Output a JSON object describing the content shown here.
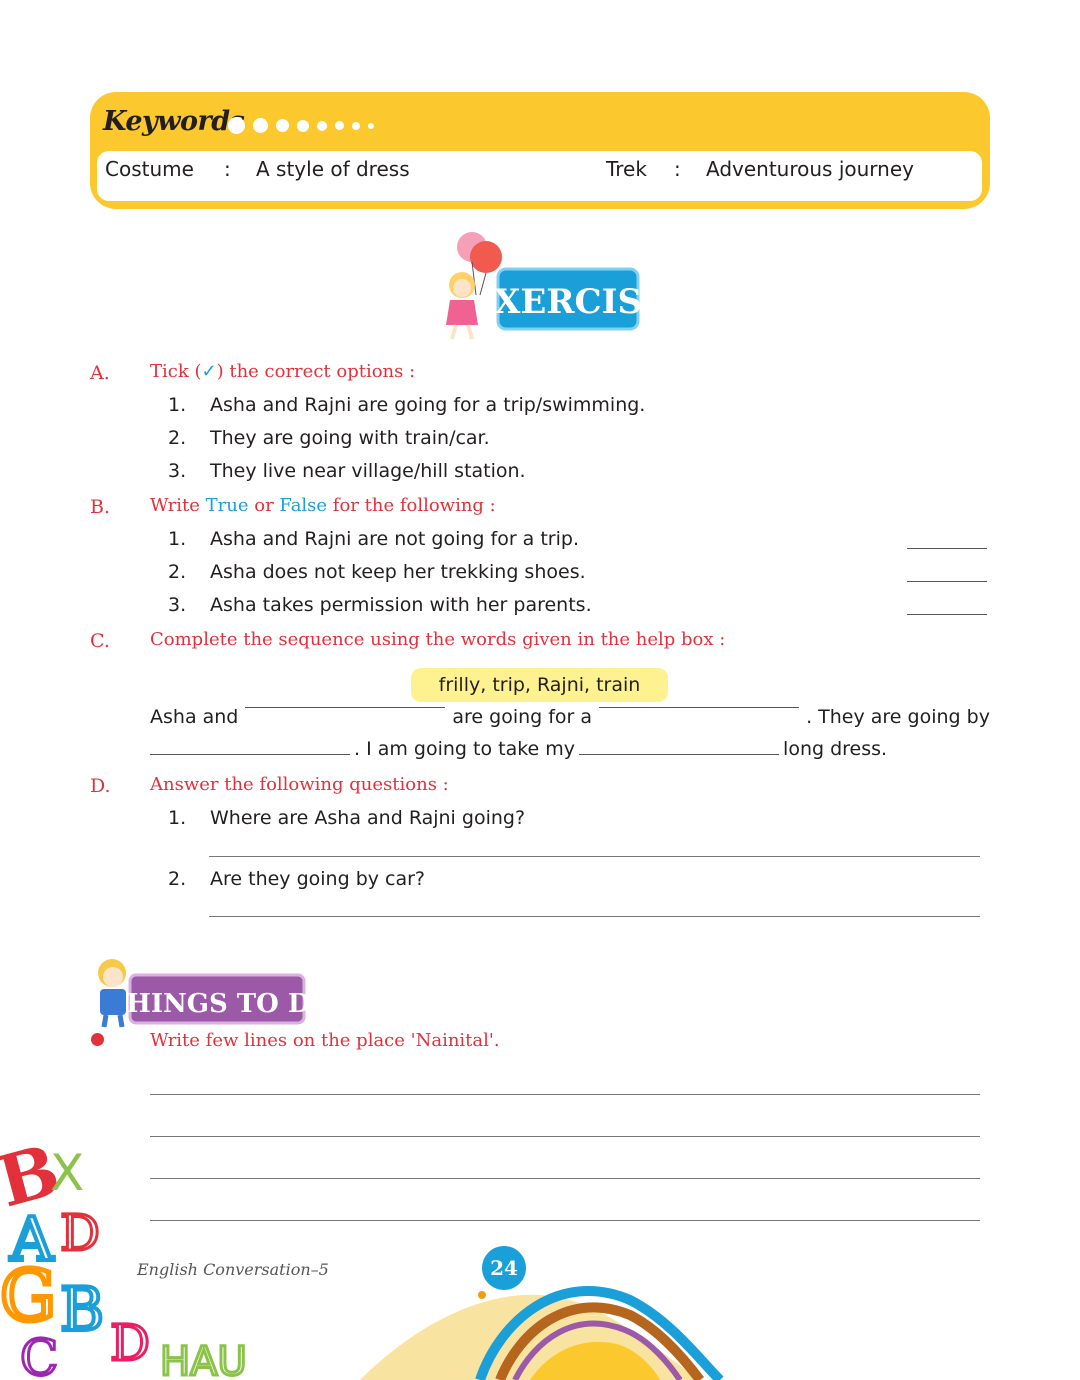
{
  "keywords": {
    "title": "Keywords",
    "entries": [
      {
        "term": "Costume",
        "sep": ":",
        "meaning": "A style of dress"
      },
      {
        "term": "Trek",
        "sep": ":",
        "meaning": "Adventurous journey"
      }
    ]
  },
  "exercise_badge": "EXERCISE",
  "sections": {
    "A": {
      "letter": "A.",
      "heading_pre": "Tick (",
      "tick": "✓",
      "heading_post": ") the correct options :",
      "items": [
        {
          "num": "1.",
          "text": "Asha and Rajni are going for a trip/swimming."
        },
        {
          "num": "2.",
          "text": "They are going with train/car."
        },
        {
          "num": "3.",
          "text": "They live near village/hill station."
        }
      ]
    },
    "B": {
      "letter": "B.",
      "heading_write": "Write ",
      "heading_true": "True",
      "heading_or": " or ",
      "heading_false": "False",
      "heading_post": " for the following :",
      "items": [
        {
          "num": "1.",
          "text": "Asha and Rajni are not going for a trip."
        },
        {
          "num": "2.",
          "text": "Asha does not keep her trekking shoes."
        },
        {
          "num": "3.",
          "text": "Asha takes permission with her parents."
        }
      ]
    },
    "C": {
      "letter": "C.",
      "heading": "Complete the sequence using the words given in the help box :",
      "help_box": "frilly, trip, Rajni, train",
      "line1_a": "Asha and",
      "line1_b": "are going for a",
      "line1_c": ". They are going by",
      "line2_a": ". I am going to take my",
      "line2_b": "long dress."
    },
    "D": {
      "letter": "D.",
      "heading": "Answer the following questions :",
      "items": [
        {
          "num": "1.",
          "text": "Where are Asha and Rajni going?"
        },
        {
          "num": "2.",
          "text": "Are they going by car?"
        }
      ]
    }
  },
  "things_to_do": {
    "title": "THINGS TO DO",
    "task": "Write few lines on the place 'Nainital'."
  },
  "footer": {
    "book": "English Conversation–5",
    "page": "24"
  },
  "colors": {
    "accent_yellow": "#fbc92e",
    "heading_red": "#e2313b",
    "blue": "#1a9fd9",
    "purple": "#9b59a8"
  }
}
